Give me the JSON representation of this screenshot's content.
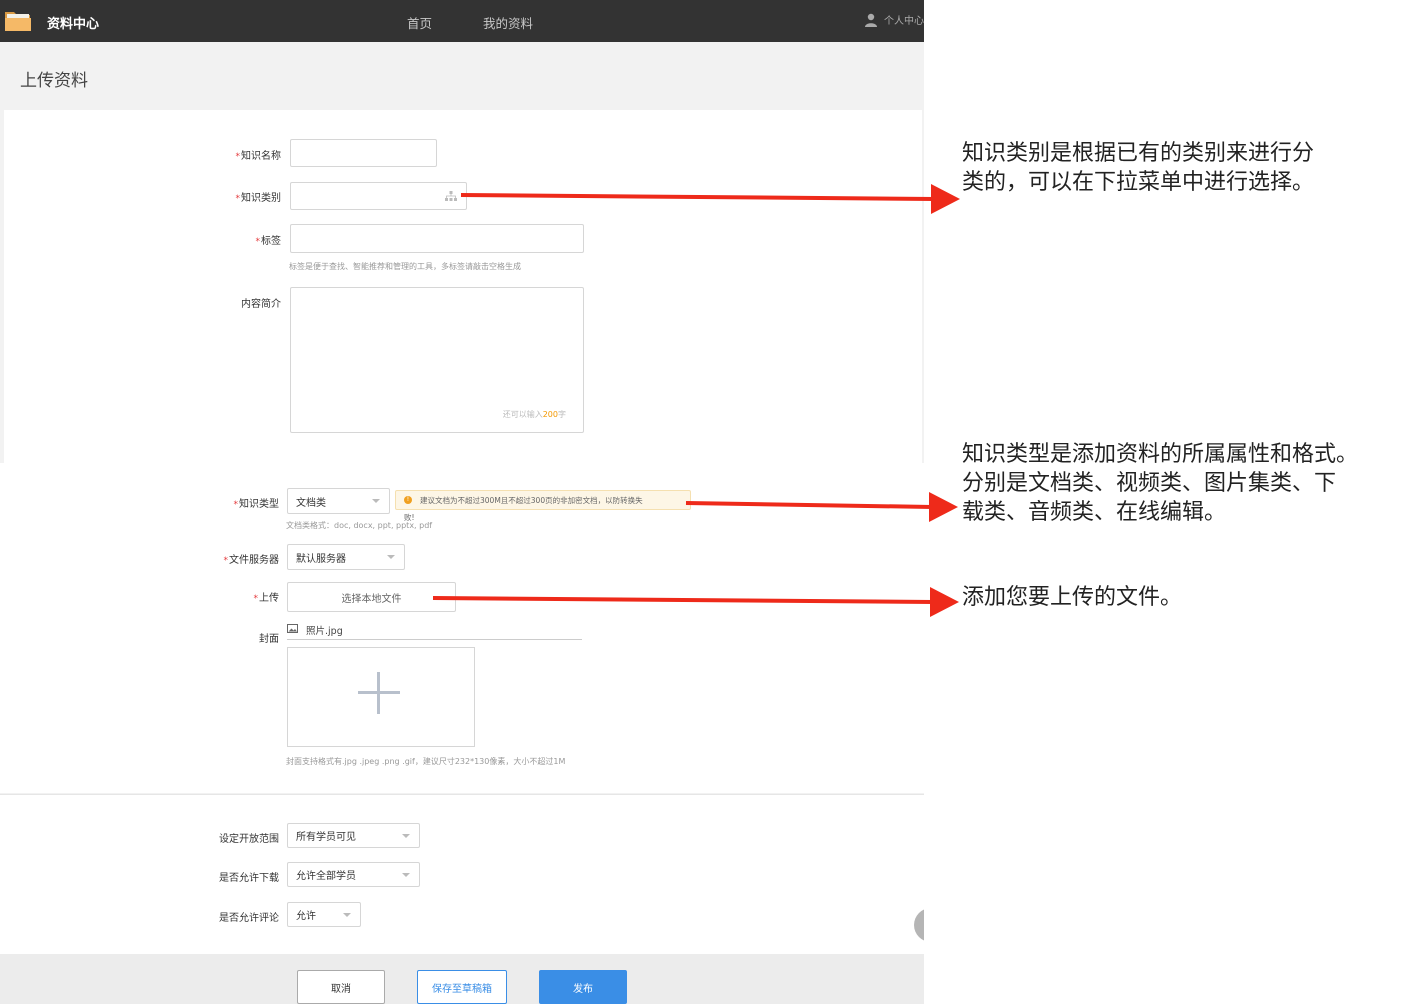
{
  "topbar": {
    "brand": "资料中心",
    "nav": [
      "首页",
      "我的资料"
    ],
    "user_label": "个人中心"
  },
  "page_title": "上传资料",
  "form": {
    "knowledge_name_label": "知识名称",
    "knowledge_category_label": "知识类别",
    "tags_label": "标签",
    "tags_hint": "标签是便于查找、智能推荐和管理的工具，多标签请敲击空格生成",
    "summary_label": "内容简介",
    "summary_counter_prefix": "还可以输入",
    "summary_counter_value": "200",
    "summary_counter_suffix": "字",
    "knowledge_type_label": "知识类型",
    "knowledge_type_value": "文档类",
    "warning_text": "建议文档为不超过300M且不超过300页的非加密文档，以防转换失",
    "warning_text_overflow": "败!",
    "format_hint": "文档类格式：doc, docx, ppt, pptx, pdf",
    "file_server_label": "文件服务器",
    "file_server_value": "默认服务器",
    "upload_label": "上传",
    "upload_button": "选择本地文件",
    "cover_label": "封面",
    "cover_file": "照片.jpg",
    "cover_hint": "封面支持格式有.jpg .jpeg .png .gif，建议尺寸232*130像素，大小不超过1M",
    "open_scope_label": "设定开放范围",
    "open_scope_value": "所有学员可见",
    "allow_download_label": "是否允许下载",
    "allow_download_value": "允许全部学员",
    "allow_comment_label": "是否允许评论",
    "allow_comment_value": "允许"
  },
  "buttons": {
    "cancel": "取消",
    "save_draft": "保存至草稿箱",
    "publish": "发布"
  },
  "annotations": {
    "note_category_line1": "知识类别是根据已有的类别来进行分",
    "note_category_line2": "类的，可以在下拉菜单中进行选择。",
    "note_type_line1": "知识类型是添加资料的所属属性和格式。",
    "note_type_line2": "分别是文档类、视频类、图片集类、下",
    "note_type_line3": "载类、音频类、在线编辑。",
    "note_upload": "添加您要上传的文件。"
  },
  "colors": {
    "topbar": "#333333",
    "arrow": "#ee2a1a",
    "primary_button": "#3a8ee6",
    "required_mark": "#e4393c",
    "counter_highlight": "#f39800"
  }
}
